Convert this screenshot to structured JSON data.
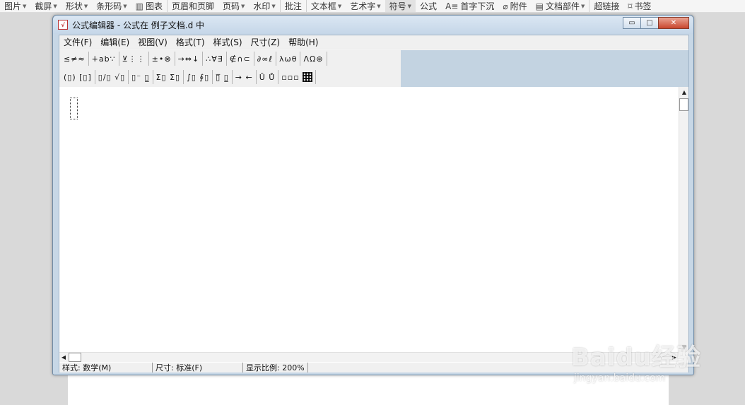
{
  "ribbon": {
    "items": [
      {
        "label": "图片",
        "caret": true
      },
      {
        "label": "截屏",
        "caret": true
      },
      {
        "label": "形状",
        "caret": true
      },
      {
        "label": "条形码",
        "caret": true
      },
      {
        "label": "图表",
        "icon": "chart-icon"
      },
      {
        "label": "页眉和页脚"
      },
      {
        "label": "页码",
        "caret": true
      },
      {
        "label": "水印",
        "caret": true
      },
      {
        "label": "批注"
      },
      {
        "label": "文本框",
        "caret": true
      },
      {
        "label": "艺术字",
        "caret": true
      },
      {
        "label": "符号",
        "caret": true,
        "active": true
      },
      {
        "label": "公式"
      },
      {
        "label": "首字下沉",
        "icon": "dropcap-icon"
      },
      {
        "label": "附件",
        "icon": "paperclip-icon"
      },
      {
        "label": "文档部件",
        "icon": "doc-parts-icon",
        "caret": true
      },
      {
        "label": "超链接"
      },
      {
        "label": "书签",
        "icon": "bookmark-icon"
      }
    ]
  },
  "window": {
    "title": "公式编辑器 - 公式在 例子文档.d 中",
    "minimize": "▭",
    "maximize": "□",
    "close": "✕"
  },
  "menu": {
    "items": [
      "文件(F)",
      "编辑(E)",
      "视图(V)",
      "格式(T)",
      "样式(S)",
      "尺寸(Z)",
      "帮助(H)"
    ]
  },
  "palette": {
    "row1": [
      "≤≠≈",
      "∔ab∵",
      "⊻⋮⋮",
      "±•⊗",
      "→⇔↓",
      "∴∀∃",
      "∉∩⊂",
      "∂∞ℓ",
      "λωθ",
      "ΛΩ⊛"
    ],
    "row2": [
      "(▯) [▯]",
      "▯/▯ √▯",
      "▯⁻ ▯̲",
      "Σ▯ Σ▯",
      "∫▯ ∮▯",
      "▯̅ ▯̲",
      "→ ←",
      "Ū Ů",
      "▫▫▫"
    ]
  },
  "status": {
    "style": "样式: 数学(M)",
    "size": "尺寸: 标准(F)",
    "zoom": "显示比例: 200%"
  },
  "scroll": {
    "up": "▲",
    "down": "▼",
    "left": "◀",
    "right": "▶"
  },
  "watermark": {
    "logo": "Baidu经验",
    "sub": "jingyan.baidu.com"
  }
}
